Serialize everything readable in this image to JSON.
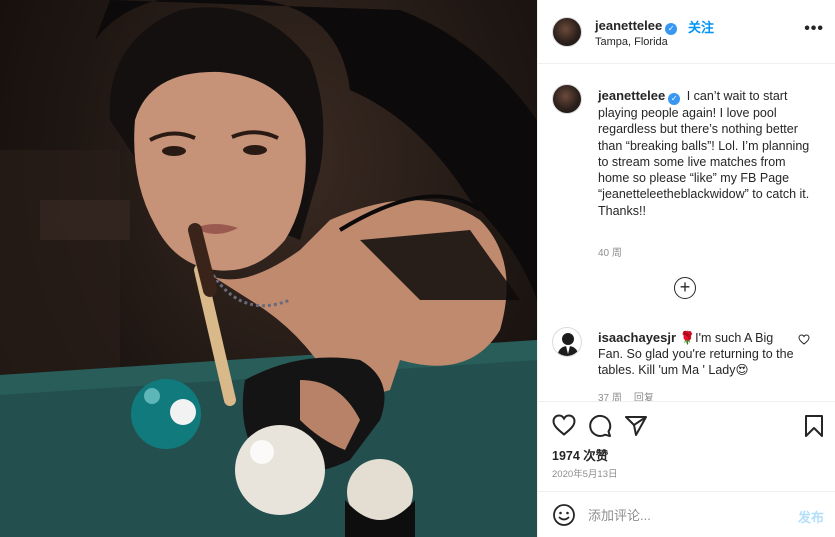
{
  "post": {
    "username": "jeanettelee",
    "verified_badge": "✓",
    "follow_label": "关注",
    "location": "Tampa, Florida",
    "more_icon": "more-options-icon",
    "more_label": "•••"
  },
  "caption": {
    "username": "jeanettelee",
    "text": "I can’t wait to start playing people again! I love pool regardless but there’s nothing better than “breaking balls”! Lol. I’m planning to stream some live matches from home so please “like” my FB Page “jeanetteleetheblackwidow” to catch it. Thanks!!",
    "age": "40 周"
  },
  "load_more": {
    "icon": "add-circle-icon",
    "label": "+"
  },
  "comments": [
    {
      "username": "isaachayesjr",
      "text": "🌹I'm such A Big Fan. So glad you're returning to the tables. Kill 'um Ma ' Lady😍",
      "age": "37 周",
      "reply_label": "回复"
    }
  ],
  "actions": {
    "like_icon": "heart-icon",
    "comment_icon": "comment-icon",
    "share_icon": "share-icon",
    "save_icon": "bookmark-icon"
  },
  "likes_label": "1974 次赞",
  "date_label": "2020年5月13日",
  "add_comment": {
    "placeholder": "添加评论...",
    "post_label": "发布",
    "emoji_icon": "emoji-icon"
  },
  "colors": {
    "accent": "#0095f6",
    "verified": "#3897f0",
    "muted": "#8e8e8e",
    "post_disabled": "#b2dffc"
  }
}
